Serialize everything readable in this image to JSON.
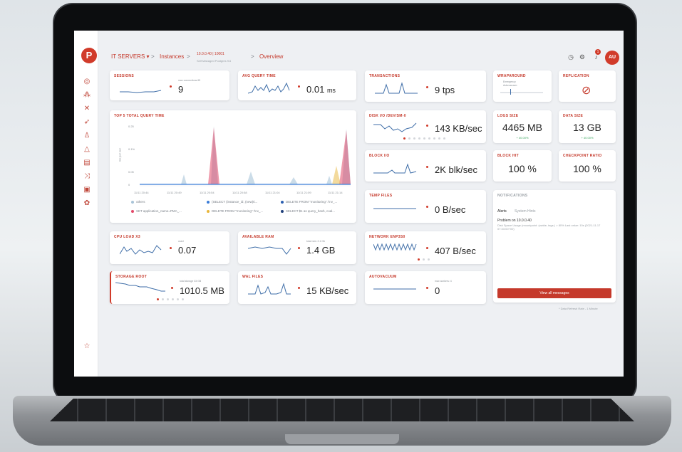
{
  "header": {
    "app": "IT SERVERS",
    "caret": "▾",
    "sep": ">",
    "instances": "Instances",
    "host": "10.0.0.40 | 10001",
    "host_sub": "Self Managed Postgres 9.6",
    "page": "Overview",
    "avatar": "AU",
    "notif_count": "1"
  },
  "cards": {
    "sessions": {
      "title": "SESSIONS",
      "sub": "max connections 65",
      "value": "9"
    },
    "avg_query": {
      "title": "AVG QUERY TIME",
      "value": "0.01",
      "unit": "ms"
    },
    "transactions": {
      "title": "TRANSACTIONS",
      "value": "9 tps"
    },
    "wraparound": {
      "title": "WRAPAROUND",
      "sub1": "Emergency",
      "sub2": "Autovacuum"
    },
    "replication": {
      "title": "REPLICATION"
    },
    "top5": {
      "title": "TOP 5 TOTAL QUERY TIME",
      "ylabel": "ms per sec",
      "yticks": [
        "0.25",
        "0.1%",
        "0.05",
        "0"
      ],
      "xticks": [
        "11/11 20:44",
        "11/11 20:49",
        "11/11 20:54",
        "11/11 20:58",
        "11/11 21:04",
        "11/11 21:09",
        "11/11 21:14"
      ],
      "legend": [
        {
          "label": "others",
          "color": "#a9c4d8"
        },
        {
          "label": "(SELECT (instance_id, (new)ti...",
          "color": "#3b7dd8"
        },
        {
          "label": "DELETE FROM \"monitoring\".\"inv_...",
          "color": "#2a5fb0"
        },
        {
          "label": "SET application_name=PMA_...",
          "color": "#e24a6a"
        },
        {
          "label": "DELETE FROM \"monitoring\".\"inv_...",
          "color": "#e8b63a"
        },
        {
          "label": "SELECT $1 as query_hash, coal...",
          "color": "#1f3f7a"
        }
      ]
    },
    "disk_io": {
      "title": "DISK I/O /DEV/SM-0",
      "value": "143 KB/sec"
    },
    "logs_size": {
      "title": "LOGS SIZE",
      "value": "4465 MB",
      "delta": "+ 40.00%"
    },
    "data_size": {
      "title": "DATA SIZE",
      "value": "13 GB",
      "delta": "+ 40.00%"
    },
    "block_io": {
      "title": "BLOCK I/O",
      "value": "2K blk/sec"
    },
    "block_hit": {
      "title": "BLOCK HIT",
      "value": "100 %"
    },
    "checkpoint": {
      "title": "CHECKPOINT RATIO",
      "value": "100 %"
    },
    "temp_files": {
      "title": "TEMP FILES",
      "value": "0 B/sec"
    },
    "notifications": {
      "title": "NOTIFICATIONS",
      "tab_alerts": "Alerts",
      "tab_hints": "System Hints",
      "problem": "Problem on 10.0.0.40",
      "detail": "Disk Space Usage (mountpoint: /pwide, tags ) > 80% Last value: 10s (2021-11-17 07:33:00+00)",
      "button": "View all messages",
      "footer": "* Data Refresh Rate - 1 Minute"
    },
    "cpu": {
      "title": "CPU LOAD X3",
      "sub": "used",
      "value": "0.07"
    },
    "ram": {
      "title": "AVAILABLE RAM",
      "sub": "total ram: 2.1 Gb",
      "value": "1.4 GB"
    },
    "network": {
      "title": "NETWORK ENP3S0",
      "value": "407 B/sec"
    },
    "storage": {
      "title": "STORAGE ROOT",
      "sub": "total storage 33 GB",
      "value": "1010.5 MB"
    },
    "wal": {
      "title": "WAL FILES",
      "value": "15 KB/sec"
    },
    "autovacuum": {
      "title": "AUTOVACUUM",
      "sub": "max workers: 4",
      "value": "0"
    }
  },
  "colors": {
    "accent": "#d13b2a",
    "line": "#3f6ea8",
    "ok": "#3aa55d"
  }
}
